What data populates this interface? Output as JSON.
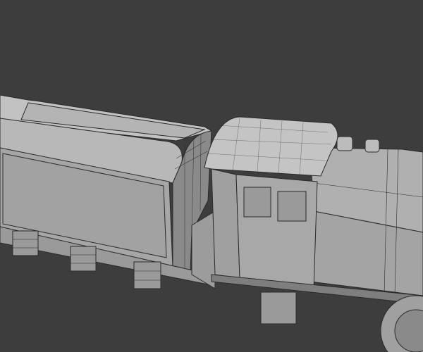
{
  "viewport": {
    "background_color": "#3d3d3d",
    "model_face_color": "#a8a8a8",
    "model_light_color": "#c4c4c4",
    "model_shadow_color": "#7a7a7a",
    "wire_color": "#2a2a2a"
  }
}
